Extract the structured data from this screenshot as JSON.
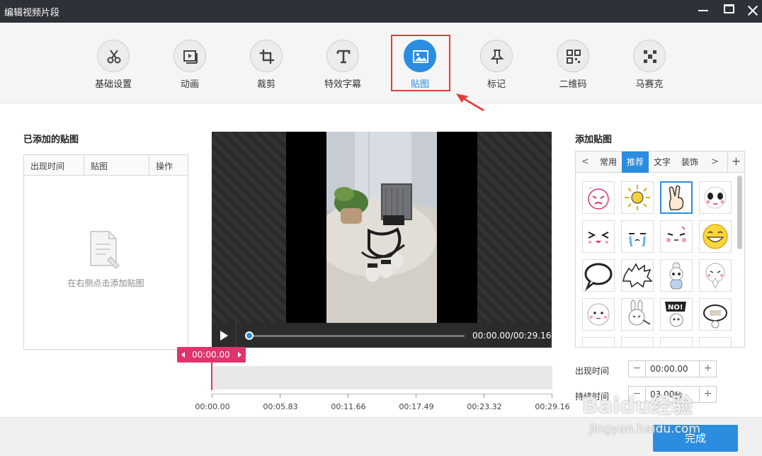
{
  "window": {
    "title": "编辑视频片段"
  },
  "toolbar": {
    "items": [
      {
        "label": "基础设置",
        "icon": "scissors-icon"
      },
      {
        "label": "动画",
        "icon": "play-frame-icon"
      },
      {
        "label": "裁剪",
        "icon": "crop-icon"
      },
      {
        "label": "特效字幕",
        "icon": "text-t-icon"
      },
      {
        "label": "贴图",
        "icon": "image-icon",
        "active": true
      },
      {
        "label": "标记",
        "icon": "pushpin-icon"
      },
      {
        "label": "二维码",
        "icon": "qrcode-icon"
      },
      {
        "label": "马赛克",
        "icon": "mosaic-icon"
      }
    ],
    "active_color": "#2a8ddf",
    "highlight_color": "#e63b3b"
  },
  "left_panel": {
    "title": "已添加的贴图",
    "columns": [
      "出现时间",
      "贴图",
      "操作"
    ],
    "empty_hint": "在右侧点击添加贴图"
  },
  "player": {
    "timecode": "00:00.00/00:29.16",
    "progress": 0
  },
  "timeline": {
    "current": "00:00.00",
    "ticks": [
      "00:00.00",
      "00:05.83",
      "00:11.66",
      "00:17.49",
      "00:23.32",
      "00:29.16"
    ],
    "marker_color": "#e0336b"
  },
  "right_panel": {
    "title": "添加贴图",
    "tabs": [
      "常用",
      "推荐",
      "文字",
      "装饰"
    ],
    "active_tab": "推荐",
    "add_label": "+",
    "prev_label": "<",
    "next_label": ">",
    "appear_label": "出现时间",
    "appear_value": "00:00.00",
    "duration_label": "持续时间",
    "duration_value": "03.00",
    "duration_unit": "秒",
    "minus": "−",
    "plus": "+"
  },
  "footer": {
    "done_label": "完成"
  },
  "watermark": {
    "brand": "Baidu经验",
    "url": "jingyan.baidu.com"
  }
}
